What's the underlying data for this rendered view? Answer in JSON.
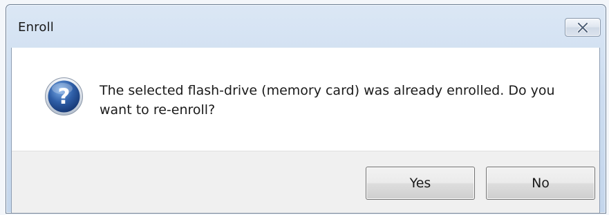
{
  "window": {
    "title": "Enroll",
    "close_icon": "close-x-icon"
  },
  "message": {
    "icon": "question-icon",
    "text_line1": "The selected flash-drive (memory card) was already enrolled. Do you",
    "text_line2": "want to re-enroll?"
  },
  "buttons": {
    "yes_label": "Yes",
    "no_label": "No"
  },
  "colors": {
    "icon_blue": "#2f5fa8",
    "titlebar": "#cdddf0",
    "button_bar": "#f0f0f0"
  }
}
